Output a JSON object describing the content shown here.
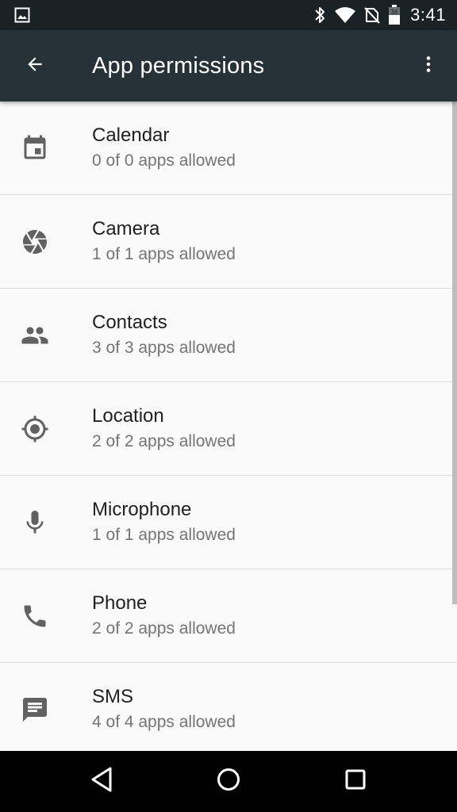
{
  "status_bar": {
    "time": "3:41",
    "icons": [
      "image-notification-icon",
      "bluetooth-icon",
      "wifi-icon",
      "no-sim-icon",
      "battery-icon"
    ],
    "battery_level": "36"
  },
  "app_bar": {
    "title": "App permissions",
    "back_icon": "arrow-back-icon",
    "overflow_icon": "more-vert-icon"
  },
  "permissions": [
    {
      "key": "calendar",
      "title": "Calendar",
      "summary": "0 of 0 apps allowed",
      "icon": "calendar-icon"
    },
    {
      "key": "camera",
      "title": "Camera",
      "summary": "1 of 1 apps allowed",
      "icon": "camera-icon"
    },
    {
      "key": "contacts",
      "title": "Contacts",
      "summary": "3 of 3 apps allowed",
      "icon": "contacts-icon"
    },
    {
      "key": "location",
      "title": "Location",
      "summary": "2 of 2 apps allowed",
      "icon": "location-icon"
    },
    {
      "key": "microphone",
      "title": "Microphone",
      "summary": "1 of 1 apps allowed",
      "icon": "microphone-icon"
    },
    {
      "key": "phone",
      "title": "Phone",
      "summary": "2 of 2 apps allowed",
      "icon": "phone-icon"
    },
    {
      "key": "sms",
      "title": "SMS",
      "summary": "4 of 4 apps allowed",
      "icon": "sms-icon"
    }
  ],
  "nav_bar": {
    "buttons": [
      "nav-back-icon",
      "nav-home-icon",
      "nav-recents-icon"
    ]
  },
  "colors": {
    "status_bar": "#1a2226",
    "app_bar": "#263238",
    "list_background": "#fafafa",
    "icon": "#616161",
    "title_text": "#212121",
    "summary_text": "#757575",
    "divider": "#dcdcdc"
  }
}
